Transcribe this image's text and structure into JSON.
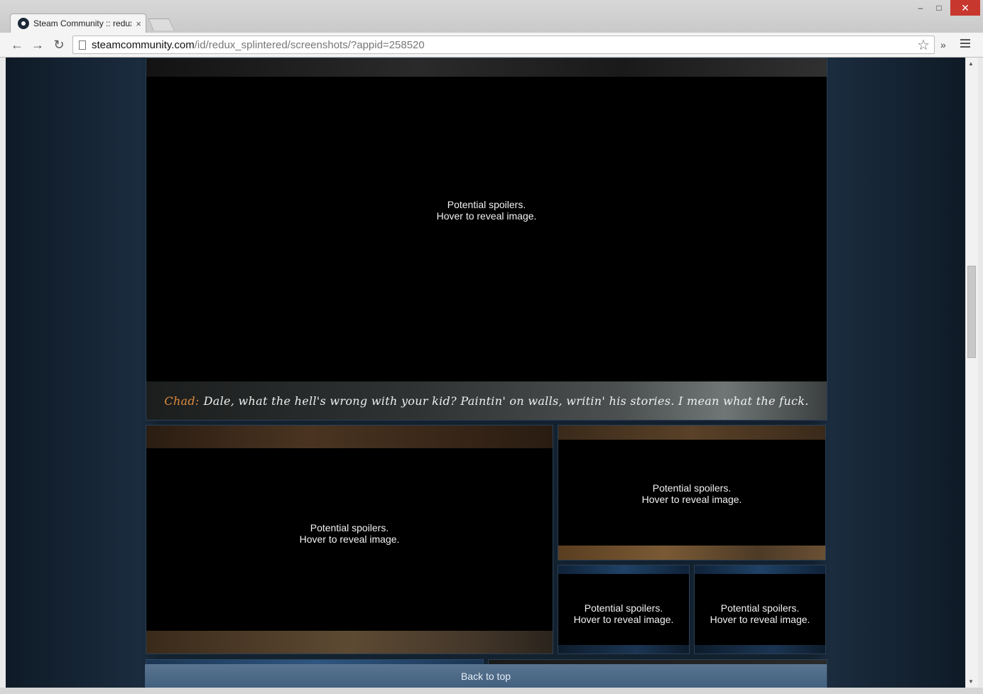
{
  "browser": {
    "tab_title": "Steam Community :: redux",
    "tab_close": "×",
    "url_host": "steamcommunity.com",
    "url_path": "/id/redux_splintered/screenshots/?appid=258520",
    "star": "☆",
    "extensions": "»",
    "win_min": "–",
    "win_max": "□",
    "win_close": "✕",
    "nav_back": "←",
    "nav_forward": "→",
    "nav_reload": "↻",
    "scroll_up": "▲",
    "scroll_down": "▼"
  },
  "screenshots": [
    {
      "line1": "Potential spoilers.",
      "line2": "Hover to reveal image."
    },
    {
      "line1": "Potential spoilers.",
      "line2": "Hover to reveal image."
    },
    {
      "line1": "Potential spoilers.",
      "line2": "Hover to reveal image."
    },
    {
      "line1": "Potential spoilers.",
      "line2": "Hover to reveal image."
    },
    {
      "line1": "Potential spoilers.",
      "line2": "Hover to reveal image."
    }
  ],
  "caption": {
    "speaker": "Chad:",
    "text": "Dale, what the hell's wrong with your kid? Paintin' on walls, writin' his stories. I mean what the fuck."
  },
  "back_to_top": "Back to top"
}
